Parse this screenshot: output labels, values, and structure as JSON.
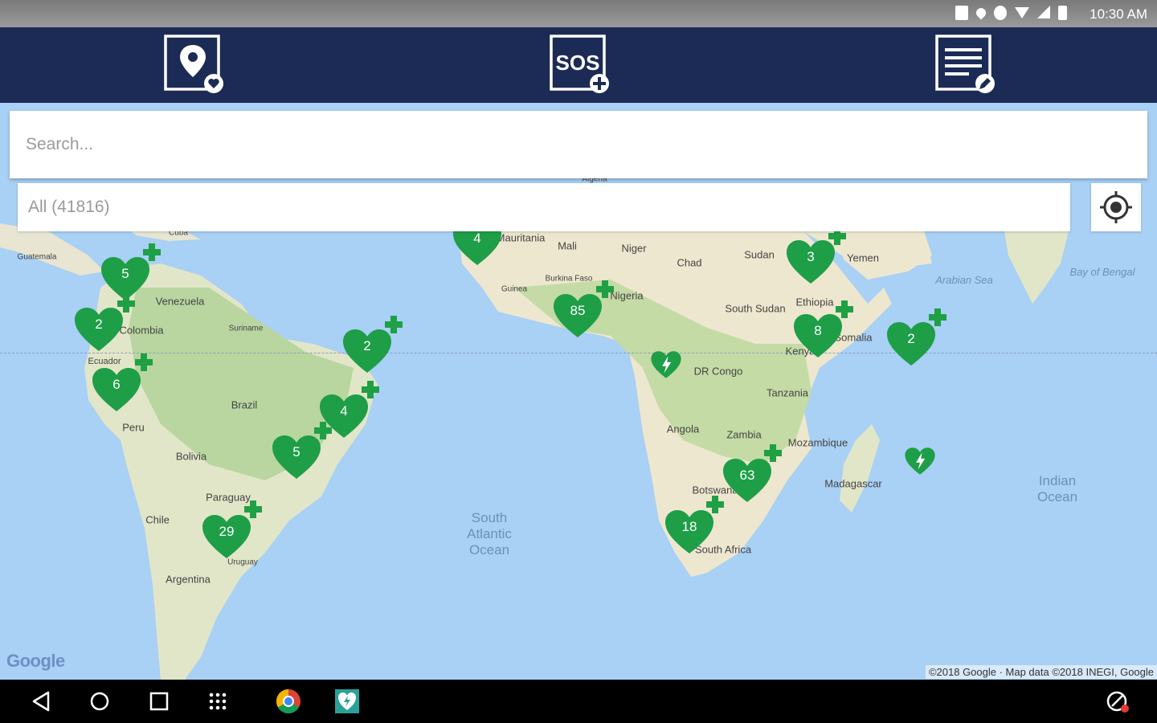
{
  "status_bar": {
    "time": "10:30 AM",
    "icons": [
      "sim-icon",
      "location-icon",
      "hotspot-icon",
      "wifi-icon",
      "signal-icon",
      "battery-icon"
    ]
  },
  "toolbar": {
    "background": "#1c2b55",
    "buttons": [
      {
        "name": "favorites-map-button",
        "icon": "map-pin-heart-icon"
      },
      {
        "name": "sos-add-button",
        "icon": "sos-plus-icon",
        "label": "SOS"
      },
      {
        "name": "edit-list-button",
        "icon": "list-edit-icon"
      }
    ]
  },
  "search": {
    "placeholder": "Search..."
  },
  "filter": {
    "selected": "All (41816)"
  },
  "map": {
    "marker_color": "#1e9e47",
    "labels": [
      {
        "text": "Mali"
      },
      {
        "text": "Niger"
      },
      {
        "text": "Chad"
      },
      {
        "text": "Sudan"
      },
      {
        "text": "Yemen"
      },
      {
        "text": "South Sudan"
      },
      {
        "text": "Ethiopia"
      },
      {
        "text": "Nigeria"
      },
      {
        "text": "DR Congo"
      },
      {
        "text": "Tanzania"
      },
      {
        "text": "Angola"
      },
      {
        "text": "Zambia"
      },
      {
        "text": "Mozambique"
      },
      {
        "text": "Madagascar"
      },
      {
        "text": "Botswana"
      },
      {
        "text": "South Africa"
      },
      {
        "text": "Venezuela"
      },
      {
        "text": "Colombia"
      },
      {
        "text": "Ecuador"
      },
      {
        "text": "Peru"
      },
      {
        "text": "Brazil"
      },
      {
        "text": "Bolivia"
      },
      {
        "text": "Paraguay"
      },
      {
        "text": "Chile"
      },
      {
        "text": "Argentina"
      },
      {
        "text": "Uruguay"
      },
      {
        "text": "Suriname"
      },
      {
        "text": "Guatemala"
      },
      {
        "text": "Cuba"
      },
      {
        "text": "Mauritania"
      },
      {
        "text": "Kenya"
      },
      {
        "text": "Somalia"
      },
      {
        "text": "Burkina Faso"
      },
      {
        "text": "Guinea"
      },
      {
        "text": "Algeria"
      }
    ],
    "ocean_labels": [
      {
        "text": "South\nAtlantic\nOcean"
      },
      {
        "text": "Indian\nOcean"
      },
      {
        "text": "Arabian Sea"
      },
      {
        "text": "Bay of Bengal"
      }
    ],
    "clusters": [
      {
        "count": "4"
      },
      {
        "count": "5"
      },
      {
        "count": "2"
      },
      {
        "count": "6"
      },
      {
        "count": "2"
      },
      {
        "count": "4"
      },
      {
        "count": "5"
      },
      {
        "count": "29"
      },
      {
        "count": "85"
      },
      {
        "count": "3"
      },
      {
        "count": "8"
      },
      {
        "count": "2"
      },
      {
        "count": "63"
      },
      {
        "count": "18"
      },
      {
        "count": ""
      },
      {
        "count": ""
      }
    ],
    "google_logo": "Google",
    "copyright": "©2018 Google · Map data ©2018 INEGI, Google"
  },
  "nav_bar": {
    "buttons": [
      "back-icon",
      "home-icon",
      "recents-icon",
      "app-drawer-icon",
      "chrome-app-icon",
      "aed-app-icon",
      "vpn-icon"
    ]
  }
}
